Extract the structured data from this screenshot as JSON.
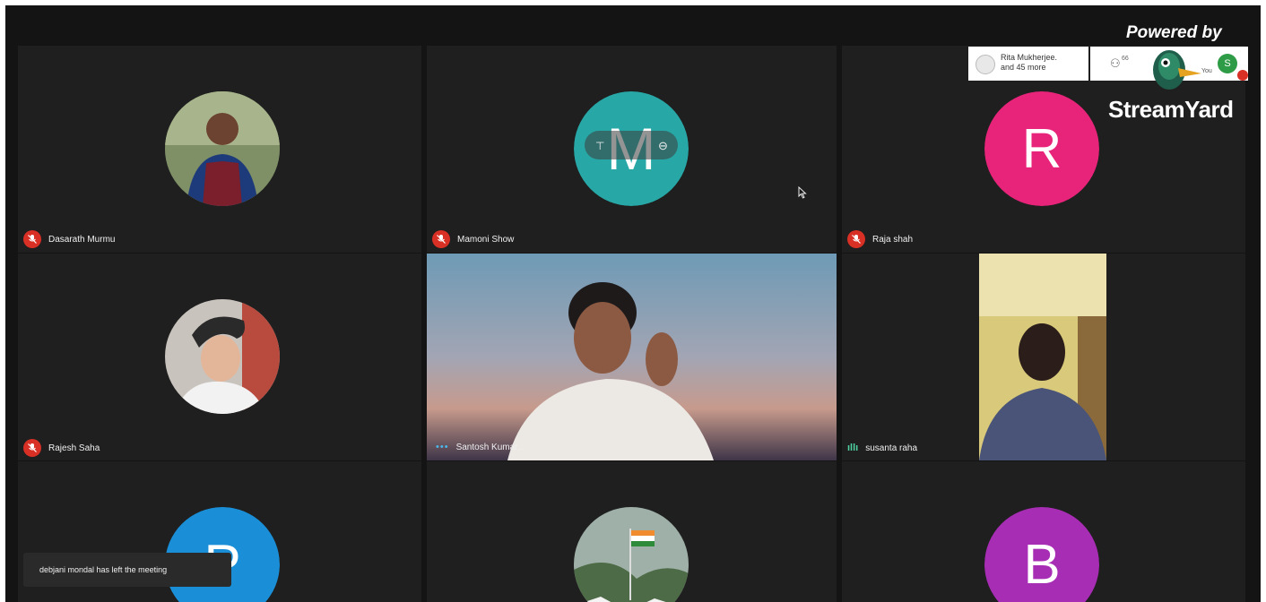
{
  "participants_chip": {
    "line1": "Rita Mukherjee.",
    "line2": "and 45 more"
  },
  "people_count": "66",
  "you_label": "You",
  "self_avatar_letter": "S",
  "branding": {
    "powered_by": "Powered by",
    "logo": "StreamYard"
  },
  "toast": "debjani mondal has left the meeting",
  "tiles": [
    {
      "name": "Dasarath Murmu",
      "mic": "muted",
      "avatar": "photo"
    },
    {
      "name": "Mamoni Show",
      "mic": "muted",
      "avatar_letter": "M",
      "avatar_color": "#27a8a6"
    },
    {
      "name": "Raja shah",
      "mic": "muted",
      "avatar_letter": "R",
      "avatar_color": "#e8247a"
    },
    {
      "name": "Rajesh Saha",
      "mic": "muted",
      "avatar": "photo"
    },
    {
      "name": "Santosh Kumar...",
      "mic": "speaking",
      "video": true
    },
    {
      "name": "susanta raha",
      "mic": "active",
      "video": true
    },
    {
      "name": "",
      "avatar_letter": "P",
      "avatar_color": "#1a8fd8"
    },
    {
      "name": "",
      "avatar": "photo-flag"
    },
    {
      "name": "",
      "avatar_letter": "B",
      "avatar_color": "#a82db5"
    }
  ],
  "colors": {
    "mic_off": "#d93025",
    "tile_bg": "#1f1f1f",
    "stage_bg": "#141414"
  }
}
